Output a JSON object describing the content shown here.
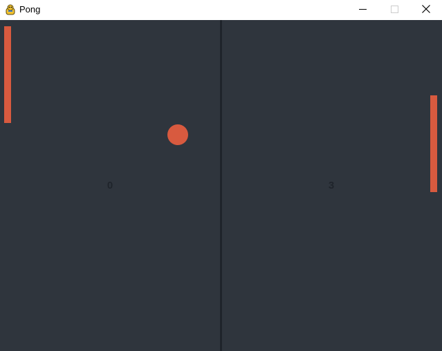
{
  "window": {
    "title": "Pong",
    "app_icon": "pygame-snake-icon",
    "controls": {
      "minimize_icon": "minimize-icon",
      "maximize_icon": "maximize-icon",
      "close_icon": "close-icon"
    }
  },
  "game": {
    "scores": {
      "left": "0",
      "right": "3"
    },
    "colors": {
      "background": "#2f353d",
      "divider": "#1f242b",
      "paddle": "#d85a3f",
      "ball": "#d85a3f",
      "score_text": "#1f242b"
    }
  }
}
